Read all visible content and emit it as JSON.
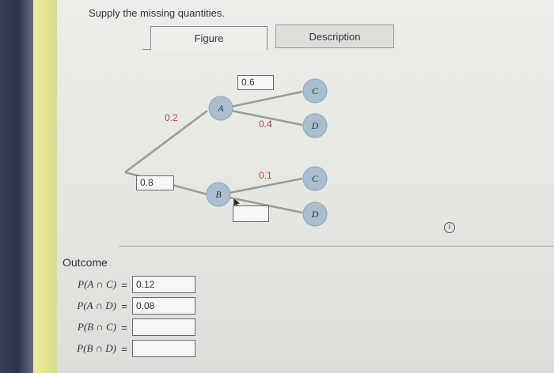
{
  "instruction": "Supply the missing quantities.",
  "tabs": [
    {
      "label": "Figure",
      "active": true
    },
    {
      "label": "Description",
      "active": false
    }
  ],
  "tree": {
    "first_branches": [
      {
        "node": "A",
        "prob_label": "0.2",
        "prob_box": ""
      },
      {
        "node": "B",
        "prob_label": "",
        "prob_box": "0.8"
      }
    ],
    "second_branches": [
      {
        "from": "A",
        "node": "C",
        "prob_label": "",
        "prob_box": "0.6"
      },
      {
        "from": "A",
        "node": "D",
        "prob_label": "0.4",
        "prob_box": ""
      },
      {
        "from": "B",
        "node": "C",
        "prob_label": "0.1",
        "prob_box": ""
      },
      {
        "from": "B",
        "node": "D",
        "prob_label": "",
        "prob_box": ""
      }
    ]
  },
  "outcome": {
    "title": "Outcome",
    "rows": [
      {
        "label": "P(A ∩ C)",
        "eq": "=",
        "value": "0.12"
      },
      {
        "label": "P(A ∩ D)",
        "eq": "=",
        "value": "0.08"
      },
      {
        "label": "P(B ∩ C)",
        "eq": "=",
        "value": ""
      },
      {
        "label": "P(B ∩ D)",
        "eq": "=",
        "value": ""
      }
    ]
  },
  "info_icon": {
    "glyph": "i"
  },
  "colors": {
    "node_fill": "#a9bfcf",
    "node_stroke": "#8fa4b4",
    "branch": "#9a9b97",
    "prob_text": "#c04040"
  }
}
